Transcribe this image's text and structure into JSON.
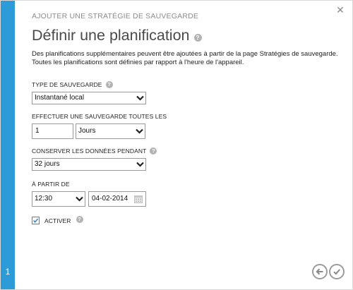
{
  "dialog": {
    "wizard_title": "AJOUTER UNE STRATÉGIE DE SAUVEGARDE",
    "page_title": "Définir une planification",
    "description_line1": "Des planifications supplémentaires peuvent être ajoutées à partir de la page Stratégies de sauvegarde.",
    "description_line2": "Toutes les planifications sont définies par rapport à l'heure de l'appareil.",
    "step_number": "1",
    "close_glyph": "✕"
  },
  "backup_type": {
    "label": "TYPE DE SAUVEGARDE",
    "value": "Instantané local"
  },
  "frequency": {
    "label": "EFFECTUER UNE SAUVEGARDE TOUTES LES",
    "number_value": "1",
    "unit_value": "Jours"
  },
  "retention": {
    "label": "CONSERVER LES DONNÉES PENDANT",
    "value": "32 jours"
  },
  "start": {
    "label": "À PARTIR DE",
    "time_value": "12:30",
    "date_value": "04-02-2014"
  },
  "enable": {
    "label": "ACTIVER",
    "checked": true
  },
  "colors": {
    "accent_strip": "#2d9bd8",
    "checkbox_border": "#3b89c9",
    "icon_gray": "#9b9b9b"
  },
  "icons": {
    "help": "?",
    "dropdown": "chevron-down-icon",
    "calendar": "calendar-icon",
    "back": "arrow-left-icon",
    "confirm": "checkmark-icon"
  }
}
